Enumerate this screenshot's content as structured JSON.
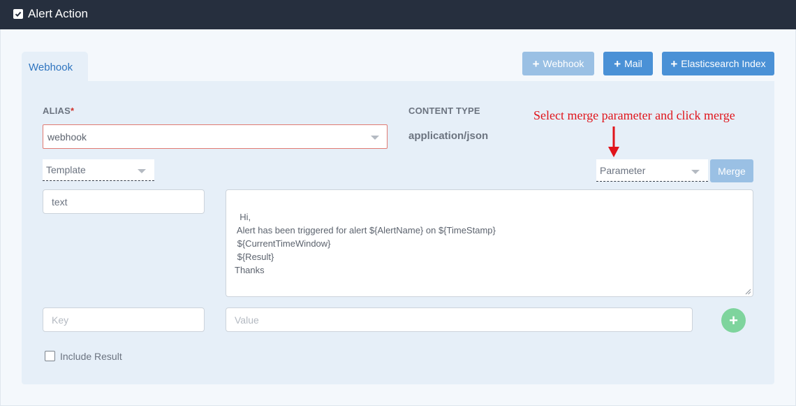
{
  "header": {
    "title": "Alert Action",
    "checked": true
  },
  "tabs": [
    {
      "label": "Webhook",
      "active": true
    }
  ],
  "actions": {
    "webhook_label": "Webhook",
    "mail_label": "Mail",
    "es_label": "Elasticsearch Index"
  },
  "form": {
    "alias_label": "ALIAS",
    "alias_required": "*",
    "alias_value": "webhook",
    "content_type_label": "CONTENT TYPE",
    "content_type_value": "application/json",
    "template_select": "Template",
    "parameter_select": "Parameter",
    "merge_label": "Merge",
    "annotation": "Select merge parameter and click merge",
    "format_input": "text",
    "body": "Hi,\n Alert has been triggered for alert ${AlertName} on ${TimeStamp}\n ${CurrentTimeWindow}\n ${Result}\nThanks",
    "key_placeholder": "Key",
    "value_placeholder": "Value",
    "include_result_label": "Include Result",
    "include_result_checked": false
  },
  "colors": {
    "header_bg": "#262f3e",
    "primary": "#4a91d6",
    "primary_disabled": "#9ac0e4",
    "annotation": "#e0141b",
    "add": "#7ed49d"
  }
}
